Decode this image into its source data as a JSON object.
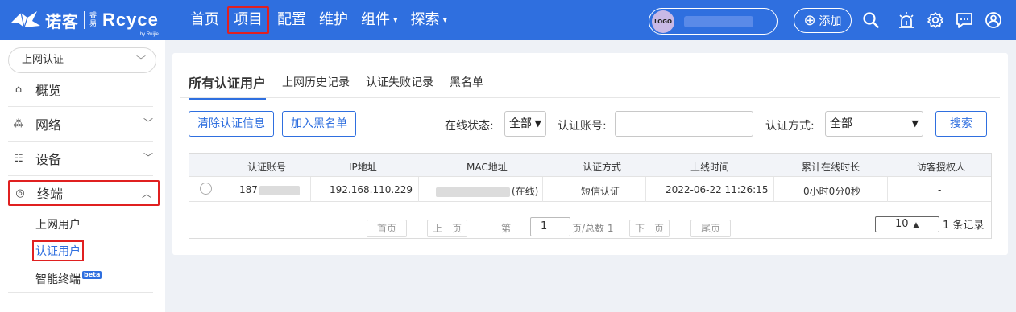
{
  "brand": {
    "cn": "诺客",
    "sub": "睿易",
    "reyee": "Rcyce",
    "ruijie": "by Ruijie"
  },
  "nav": {
    "items": [
      {
        "label": "首页"
      },
      {
        "label": "项目"
      },
      {
        "label": "配置"
      },
      {
        "label": "维护"
      },
      {
        "label": "组件"
      },
      {
        "label": "探索"
      }
    ],
    "logo_text": "LOGO",
    "add_label": "添加"
  },
  "sidebar": {
    "select_value": "上网认证",
    "items": [
      {
        "label": "概览",
        "icon": "home-icon"
      },
      {
        "label": "网络",
        "icon": "network-icon"
      },
      {
        "label": "设备",
        "icon": "device-icon"
      },
      {
        "label": "终端",
        "icon": "terminal-icon"
      }
    ],
    "sub_items": [
      {
        "label": "上网用户"
      },
      {
        "label": "认证用户"
      },
      {
        "label": "智能终端",
        "badge": "beta"
      }
    ]
  },
  "tabs": [
    "所有认证用户",
    "上网历史记录",
    "认证失败记录",
    "黑名单"
  ],
  "toolbar": {
    "clear_label": "清除认证信息",
    "blacklist_label": "加入黑名单",
    "online_status_label": "在线状态:",
    "online_status_value": "全部",
    "account_label": "认证账号:",
    "account_value": "",
    "method_label": "认证方式:",
    "method_value": "全部",
    "search_label": "搜索"
  },
  "table": {
    "headers": [
      "认证账号",
      "IP地址",
      "MAC地址",
      "认证方式",
      "上线时间",
      "累计在线时长",
      "访客授权人"
    ],
    "rows": [
      {
        "account": "187",
        "ip": "192.168.110.229",
        "mac_suffix": "(在线)",
        "method": "短信认证",
        "online_time": "2022-06-22 11:26:15",
        "duration": "0小时0分0秒",
        "authorizer": "-"
      }
    ]
  },
  "pagination": {
    "first": "首页",
    "prev": "上一页",
    "page_prefix": "第",
    "page_value": "1",
    "page_suffix": "页/总数 1",
    "next": "下一页",
    "last": "尾页",
    "page_size": "10",
    "total": "1 条记录"
  }
}
